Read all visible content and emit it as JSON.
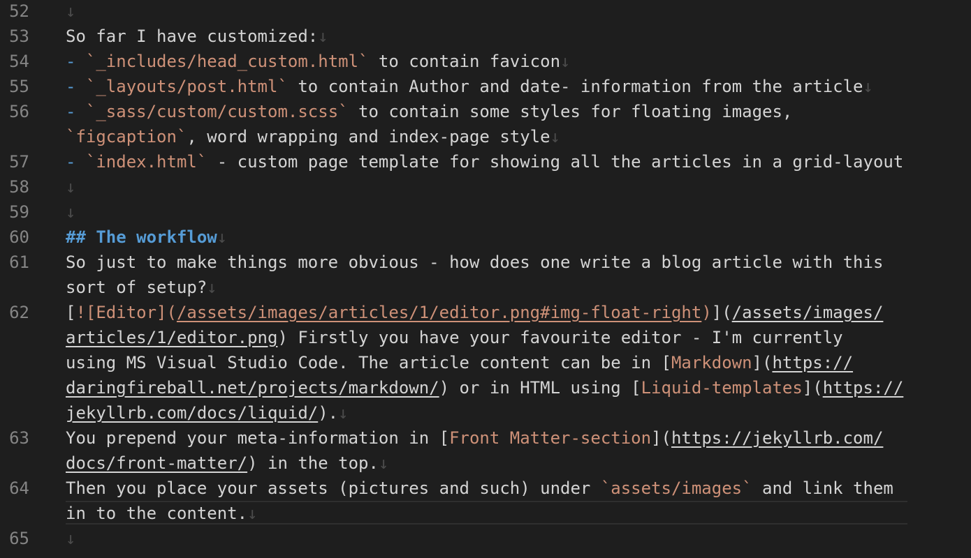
{
  "editor": {
    "lines": [
      {
        "ln": "52",
        "tokens": [
          {
            "t": "↓",
            "k": "ws"
          }
        ]
      },
      {
        "ln": "53",
        "tokens": [
          {
            "t": "So far I have customized:",
            "k": "text"
          },
          {
            "t": "↓",
            "k": "ws"
          }
        ]
      },
      {
        "ln": "54",
        "tokens": [
          {
            "t": "- ",
            "k": "bullet"
          },
          {
            "t": "`_includes/head_custom.html`",
            "k": "code"
          },
          {
            "t": " to contain favicon",
            "k": "text"
          },
          {
            "t": "↓",
            "k": "ws"
          }
        ]
      },
      {
        "ln": "55",
        "tokens": [
          {
            "t": "- ",
            "k": "bullet"
          },
          {
            "t": "`_layouts/post.html`",
            "k": "code"
          },
          {
            "t": " to contain Author and date- information from the article",
            "k": "text"
          },
          {
            "t": "↓",
            "k": "ws"
          }
        ]
      },
      {
        "ln": "56",
        "tokens": [
          {
            "t": "- ",
            "k": "bullet"
          },
          {
            "t": "`_sass/custom/custom.scss`",
            "k": "code"
          },
          {
            "t": " to contain some styles for floating images,",
            "k": "text"
          }
        ]
      },
      {
        "ln": "",
        "tokens": [
          {
            "t": "`figcaption`",
            "k": "code"
          },
          {
            "t": ", word wrapping and index-page style",
            "k": "text"
          },
          {
            "t": "↓",
            "k": "ws"
          }
        ]
      },
      {
        "ln": "57",
        "tokens": [
          {
            "t": "- ",
            "k": "bullet"
          },
          {
            "t": "`index.html`",
            "k": "code"
          },
          {
            "t": " - custom page template for showing all the articles in a grid-layout",
            "k": "text"
          }
        ]
      },
      {
        "ln": "58",
        "tokens": [
          {
            "t": "↓",
            "k": "ws"
          }
        ]
      },
      {
        "ln": "59",
        "tokens": [
          {
            "t": "↓",
            "k": "ws"
          }
        ]
      },
      {
        "ln": "60",
        "tokens": [
          {
            "t": "## The workflow",
            "k": "heading"
          },
          {
            "t": "↓",
            "k": "ws"
          }
        ]
      },
      {
        "ln": "61",
        "tokens": [
          {
            "t": "So just to make things more obvious - how does one write a blog article with this",
            "k": "text"
          }
        ]
      },
      {
        "ln": "",
        "tokens": [
          {
            "t": "sort of setup?",
            "k": "text"
          },
          {
            "t": "↓",
            "k": "ws"
          }
        ]
      },
      {
        "ln": "62",
        "tokens": [
          {
            "t": "[",
            "k": "punct"
          },
          {
            "t": "![Editor]",
            "k": "linktext"
          },
          {
            "t": "(",
            "k": "linktext"
          },
          {
            "t": "/assets/images/articles/1/editor.png#img-float-right",
            "k": "urlc"
          },
          {
            "t": ")",
            "k": "linktext"
          },
          {
            "t": "](",
            "k": "punct"
          },
          {
            "t": "/assets/images/",
            "k": "url"
          }
        ]
      },
      {
        "ln": "",
        "tokens": [
          {
            "t": "articles/1/editor.png",
            "k": "url"
          },
          {
            "t": ") Firstly you have your favourite editor - I'm currently",
            "k": "text"
          }
        ]
      },
      {
        "ln": "",
        "tokens": [
          {
            "t": "using MS Visual Studio Code. The article content can be in [",
            "k": "text"
          },
          {
            "t": "Markdown",
            "k": "linktext"
          },
          {
            "t": "](",
            "k": "punct"
          },
          {
            "t": "https://",
            "k": "url"
          }
        ]
      },
      {
        "ln": "",
        "tokens": [
          {
            "t": "daringfireball.net/projects/markdown/",
            "k": "url"
          },
          {
            "t": ") or in HTML using [",
            "k": "text"
          },
          {
            "t": "Liquid-templates",
            "k": "linktext"
          },
          {
            "t": "](",
            "k": "punct"
          },
          {
            "t": "https://",
            "k": "url"
          }
        ]
      },
      {
        "ln": "",
        "tokens": [
          {
            "t": "jekyllrb.com/docs/liquid/",
            "k": "url"
          },
          {
            "t": ").",
            "k": "text"
          },
          {
            "t": "↓",
            "k": "ws"
          }
        ]
      },
      {
        "ln": "63",
        "tokens": [
          {
            "t": "You prepend your meta-information in [",
            "k": "text"
          },
          {
            "t": "Front Matter-section",
            "k": "linktext"
          },
          {
            "t": "](",
            "k": "punct"
          },
          {
            "t": "https://jekyllrb.com/",
            "k": "url"
          }
        ]
      },
      {
        "ln": "",
        "tokens": [
          {
            "t": "docs/front-matter/",
            "k": "url"
          },
          {
            "t": ") in the top.",
            "k": "text"
          },
          {
            "t": "↓",
            "k": "ws"
          }
        ]
      },
      {
        "ln": "64",
        "tokens": [
          {
            "t": "Then you place your assets (pictures and such) under ",
            "k": "text"
          },
          {
            "t": "`assets/images`",
            "k": "code"
          },
          {
            "t": " and link them",
            "k": "text"
          }
        ]
      },
      {
        "ln": "",
        "tokens": [
          {
            "t": "in to the content.",
            "k": "text"
          },
          {
            "t": "↓",
            "k": "ws"
          }
        ]
      },
      {
        "ln": "65",
        "tokens": [
          {
            "t": "↓",
            "k": "ws"
          }
        ]
      }
    ]
  }
}
